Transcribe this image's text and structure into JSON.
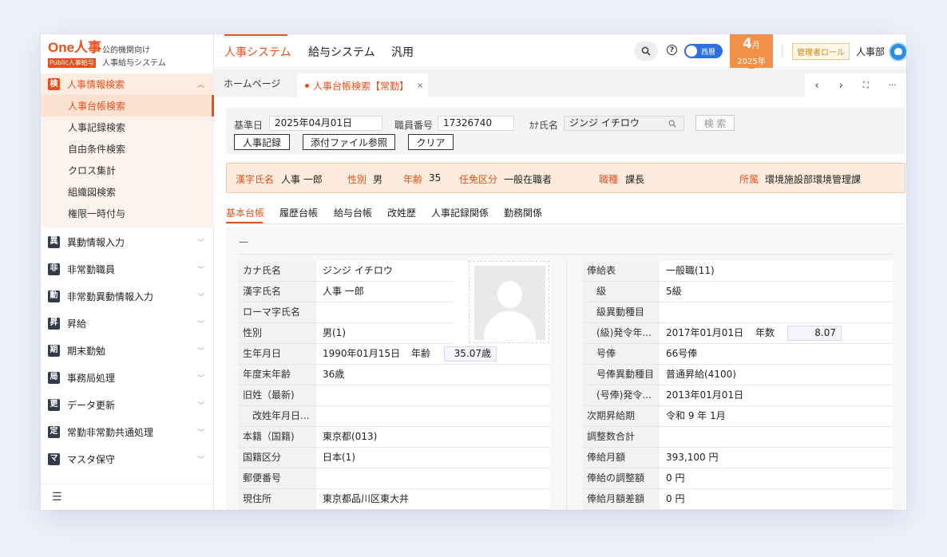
{
  "logo": {
    "main": "One人事",
    "sub": "Public人事給与",
    "line1": "公的機関向け",
    "line2": "人事給与システム"
  },
  "sidebar": {
    "open_section": {
      "badge": "検",
      "label": "人事情報検索"
    },
    "subitems": [
      "人事台帳検索",
      "人事記録検索",
      "自由条件検索",
      "クロス集計",
      "組織図検索",
      "権限一時付与"
    ],
    "items": [
      {
        "badge": "異",
        "label": "異動情報入力"
      },
      {
        "badge": "非",
        "label": "非常勤職員"
      },
      {
        "badge": "動",
        "label": "非常勤異動情報入力"
      },
      {
        "badge": "昇",
        "label": "昇給"
      },
      {
        "badge": "期",
        "label": "期末勤勉"
      },
      {
        "badge": "局",
        "label": "事務局処理"
      },
      {
        "badge": "更",
        "label": "データ更新"
      },
      {
        "badge": "定",
        "label": "常勤非常勤共通処理"
      },
      {
        "badge": "マ",
        "label": "マスタ保守"
      }
    ],
    "collapse_glyph": "☰"
  },
  "header": {
    "tabs": [
      "人事システム",
      "給与システム",
      "汎用"
    ],
    "toggle_label": "西暦",
    "month": "4",
    "month_unit": "月",
    "year": "2025年",
    "role": "管理者ロール",
    "dept": "人事部"
  },
  "page_tabs": {
    "home": "ホームページ",
    "active": "人事台帳検索【常勤】",
    "close": "×"
  },
  "tab_controls": [
    "‹",
    "›",
    "⛶",
    "···"
  ],
  "search": {
    "base_date_label": "基準日",
    "base_date": "2025年04月01日",
    "emp_no_label": "職員番号",
    "emp_no": "17326740",
    "kana_label": "ｶﾅ氏名",
    "kana": "ジンジ イチロウ",
    "search_btn": "検 索",
    "btn_record": "人事記録",
    "btn_attach": "添付ファイル参照",
    "btn_clear": "クリア"
  },
  "info": {
    "kanji_name_label": "漢字氏名",
    "kanji_name": "人事 一郎",
    "gender_label": "性別",
    "gender": "男",
    "age_label": "年齢",
    "age": "35",
    "appoint_label": "任免区分",
    "appoint": "一般在職者",
    "post_label": "職種",
    "post": "課長",
    "dept_label": "所属",
    "dept": "環境施設部環境管理課"
  },
  "detail_tabs": [
    "基本台帳",
    "履歴台帳",
    "給与台帳",
    "改姓歴",
    "人事記録関係",
    "勤務関係"
  ],
  "sheet": {
    "dash": "—",
    "left": [
      {
        "k": "カナ氏名",
        "v": "ジンジ イチロウ"
      },
      {
        "k": "漢字氏名",
        "v": "人事 一郎"
      },
      {
        "k": "ローマ字氏名",
        "v": ""
      },
      {
        "k": "性別",
        "v": "男(1)"
      },
      {
        "k": "生年月日",
        "v": "1990年01月15日",
        "extra_label": "年齢",
        "extra_value": "35.07歳"
      },
      {
        "k": "年度末年齢",
        "v": "36歳"
      },
      {
        "k": "旧姓（最新)",
        "v": ""
      },
      {
        "k": "　改姓年月日...",
        "v": ""
      },
      {
        "k": "本籍（国籍)",
        "v": "東京都(013)"
      },
      {
        "k": "国籍区分",
        "v": "日本(1)"
      },
      {
        "k": "郵便番号",
        "v": ""
      },
      {
        "k": "現住所",
        "v": "東京都品川区東大井"
      }
    ],
    "right": [
      {
        "k": "俸給表",
        "v": "一般職(11)"
      },
      {
        "k": "　級",
        "v": "5級"
      },
      {
        "k": "　級異動種目",
        "v": ""
      },
      {
        "k": "　(級)発令年...",
        "v": "2017年01月01日",
        "extra_label": "年数",
        "extra_value": "8.07"
      },
      {
        "k": "　号俸",
        "v": "66号俸"
      },
      {
        "k": "　号俸異動種目",
        "v": "普通昇給(4100)"
      },
      {
        "k": "　(号俸)発令...",
        "v": "2013年01月01日"
      },
      {
        "k": "次期昇給期",
        "v": "令和 9 年  1月"
      },
      {
        "k": "調整数合計",
        "v": ""
      },
      {
        "k": "俸給月額",
        "v": "393,100 円"
      },
      {
        "k": "俸給の調整額",
        "v": "0 円"
      },
      {
        "k": "俸給月額差額",
        "v": "0 円"
      }
    ]
  },
  "colors": {
    "accent": "#e8501e",
    "month_box": "#f29048",
    "toggle": "#2b6fe0",
    "dark_badge": "#333a48"
  }
}
